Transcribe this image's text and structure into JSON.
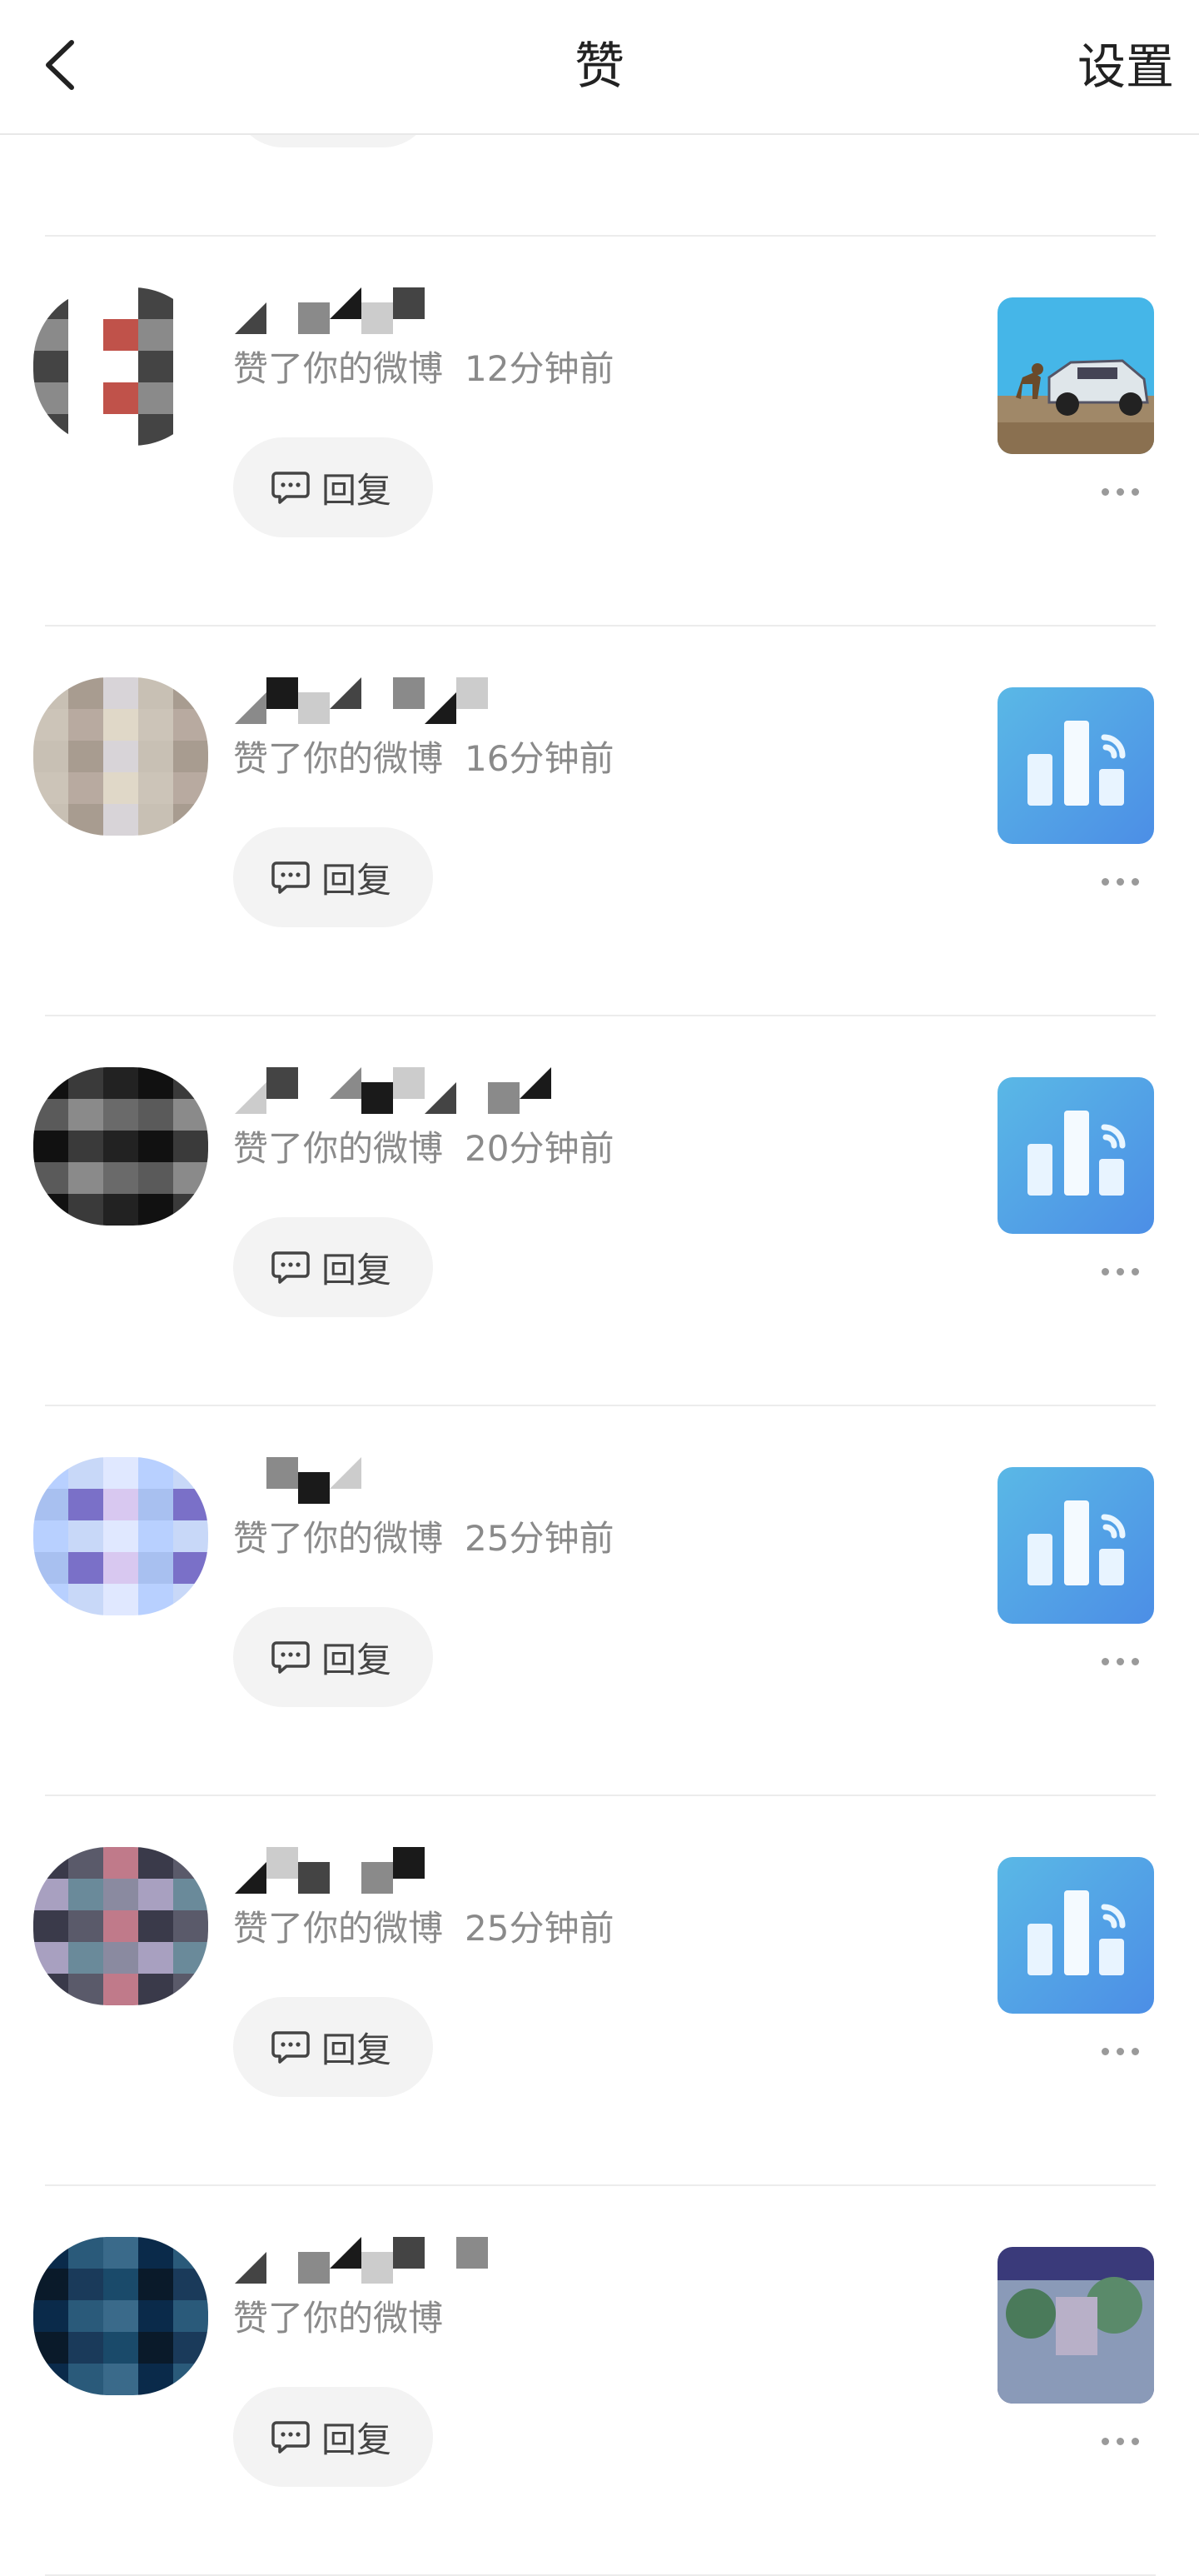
{
  "header": {
    "title": "赞",
    "settings_label": "设置"
  },
  "items": [
    {
      "action": "赞了你的微博",
      "time": "12分钟前",
      "reply_label": "回复",
      "thumbnail": "car-dog-photo",
      "avatar_colors": [
        "#ffffff",
        "#f4d4d4",
        "#e8b0b0",
        "#ffffff",
        "#c87a7a",
        "#fbe6e6"
      ]
    },
    {
      "action": "赞了你的微博",
      "time": "12分钟前",
      "reply_label": "回复",
      "thumbnail": "car-dog-photo",
      "avatar_colors": [
        "#ffffff",
        "#444444",
        "#c0524a",
        "#ffffff",
        "#8a8a8a",
        "#ffffff"
      ]
    },
    {
      "action": "赞了你的微博",
      "time": "16分钟前",
      "reply_label": "回复",
      "thumbnail": "bar-chart-app-icon",
      "avatar_colors": [
        "#d8d4d8",
        "#b8aaa0",
        "#c8c0b4",
        "#e0d8c8",
        "#a89c90",
        "#ccc4b8"
      ]
    },
    {
      "action": "赞了你的微博",
      "time": "20分钟前",
      "reply_label": "回复",
      "thumbnail": "bar-chart-app-icon",
      "avatar_colors": [
        "#5a5a5a",
        "#222222",
        "#8a8a8a",
        "#111111",
        "#6a6a6a",
        "#3a3a3a"
      ]
    },
    {
      "action": "赞了你的微博",
      "time": "25分钟前",
      "reply_label": "回复",
      "thumbnail": "bar-chart-app-icon",
      "avatar_colors": [
        "#c8d8f8",
        "#a8c0f0",
        "#e0e8ff",
        "#7a70c8",
        "#b8d0ff",
        "#d8c8f0"
      ]
    },
    {
      "action": "赞了你的微博",
      "time": "25分钟前",
      "reply_label": "回复",
      "thumbnail": "bar-chart-app-icon",
      "avatar_colors": [
        "#8a8aa0",
        "#5a5a6a",
        "#a8a0c0",
        "#c07a8a",
        "#6a8a9a",
        "#3a3a4a"
      ]
    },
    {
      "action": "赞了你的微博",
      "time": "",
      "reply_label": "回复",
      "thumbnail": "street-photo",
      "avatar_colors": [
        "#0a2a4a",
        "#1a4a6a",
        "#2a5a7a",
        "#0a1a2a",
        "#3a6a8a",
        "#1a3a5a"
      ]
    }
  ],
  "colors": {
    "accent_blue": "#5ba7e8",
    "reply_bg": "#f3f3f3",
    "meta_text": "#8a8a8a"
  }
}
